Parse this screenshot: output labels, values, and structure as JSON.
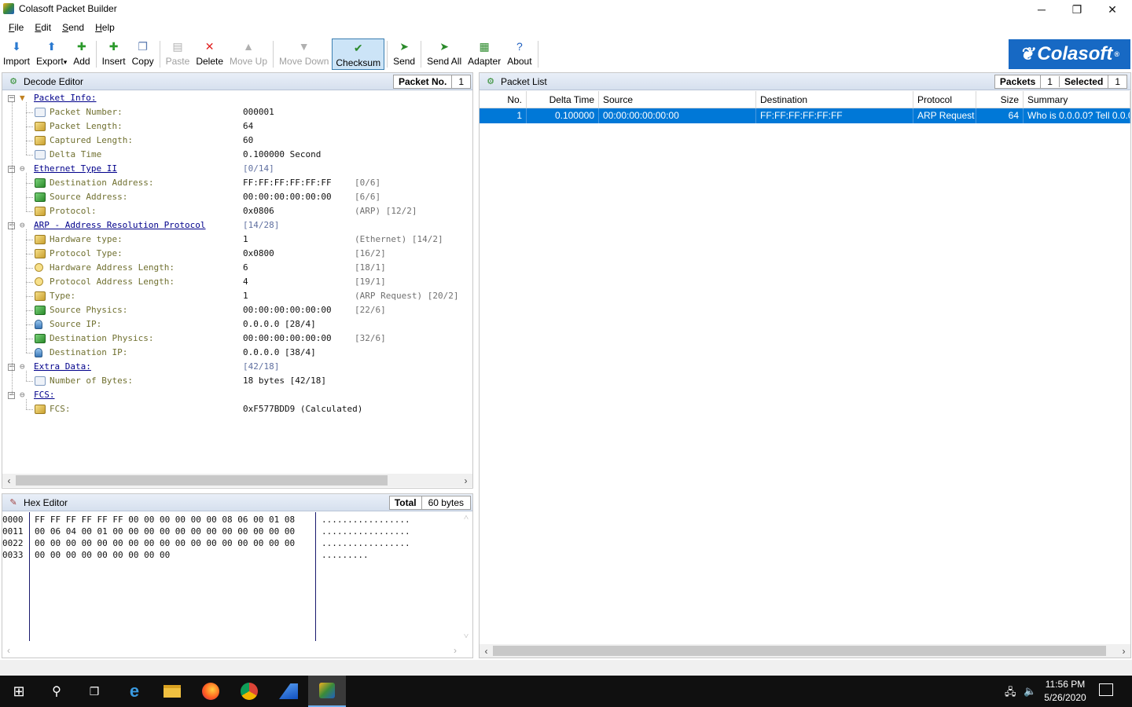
{
  "window": {
    "title": "Colasoft Packet Builder",
    "minimize": "─",
    "restore": "❐",
    "close": "✕"
  },
  "menu": [
    "File",
    "Edit",
    "Send",
    "Help"
  ],
  "toolbar": [
    {
      "label": "Import",
      "icon": "import-icon",
      "glyph": "⬇",
      "state": "normal"
    },
    {
      "label": "Export",
      "icon": "export-icon",
      "glyph": "⬆",
      "state": "normal",
      "dropdown": "▾"
    },
    {
      "label": "Add",
      "icon": "add-icon",
      "glyph": "✚",
      "state": "normal"
    },
    {
      "label": "Insert",
      "icon": "insert-icon",
      "glyph": "✚",
      "state": "normal"
    },
    {
      "label": "Copy",
      "icon": "copy-icon",
      "glyph": "❐",
      "state": "normal"
    },
    {
      "label": "Paste",
      "icon": "paste-icon",
      "glyph": "▤",
      "state": "disabled"
    },
    {
      "label": "Delete",
      "icon": "delete-icon",
      "glyph": "✕",
      "state": "normal"
    },
    {
      "label": "Move Up",
      "icon": "move-up-icon",
      "glyph": "▲",
      "state": "disabled"
    },
    {
      "label": "Move Down",
      "icon": "move-down-icon",
      "glyph": "▼",
      "state": "disabled"
    },
    {
      "label": "Checksum",
      "icon": "checksum-icon",
      "glyph": "✔",
      "state": "active"
    },
    {
      "label": "Send",
      "icon": "send-icon",
      "glyph": "➤",
      "state": "normal"
    },
    {
      "label": "Send All",
      "icon": "send-all-icon",
      "glyph": "➤",
      "state": "normal"
    },
    {
      "label": "Adapter",
      "icon": "adapter-icon",
      "glyph": "▦",
      "state": "normal"
    },
    {
      "label": "About",
      "icon": "about-icon",
      "glyph": "?",
      "state": "normal"
    }
  ],
  "logo": {
    "text": "Colasoft",
    "mark": "®"
  },
  "decode_editor": {
    "title": "Decode Editor",
    "packet_no_label": "Packet No.",
    "packet_no_value": "1",
    "rows": [
      {
        "level": 0,
        "kind": "group",
        "icon": "filter-icon",
        "label": "Packet Info:",
        "value": "",
        "extra": ""
      },
      {
        "level": 1,
        "kind": "field",
        "icon": "doc",
        "label": "Packet Number:",
        "value": "000001",
        "extra": ""
      },
      {
        "level": 1,
        "kind": "field",
        "icon": "key",
        "label": "Packet Length:",
        "value": "64",
        "extra": ""
      },
      {
        "level": 1,
        "kind": "field",
        "icon": "key",
        "label": "Captured Length:",
        "value": "60",
        "extra": ""
      },
      {
        "level": 1,
        "kind": "field",
        "icon": "doc",
        "label": "Delta Time",
        "value": "0.100000 Second",
        "extra": ""
      },
      {
        "level": 0,
        "kind": "group",
        "icon": "circle-icon",
        "label": "Ethernet Type II",
        "value": "[0/14]",
        "extra": ""
      },
      {
        "level": 1,
        "kind": "field",
        "icon": "net",
        "label": "Destination Address:",
        "value": "FF:FF:FF:FF:FF:FF",
        "extra": "[0/6]"
      },
      {
        "level": 1,
        "kind": "field",
        "icon": "net",
        "label": "Source Address:",
        "value": "00:00:00:00:00:00",
        "extra": "[6/6]"
      },
      {
        "level": 1,
        "kind": "field",
        "icon": "key",
        "label": "Protocol:",
        "value": "0x0806",
        "extra": "(ARP)  [12/2]"
      },
      {
        "level": 0,
        "kind": "group",
        "icon": "circle-icon",
        "label": "ARP - Address Resolution Protocol",
        "value": "[14/28]",
        "extra": ""
      },
      {
        "level": 1,
        "kind": "field",
        "icon": "key",
        "label": "Hardware type:",
        "value": "1",
        "extra": "(Ethernet)  [14/2]"
      },
      {
        "level": 1,
        "kind": "field",
        "icon": "key",
        "label": "Protocol Type:",
        "value": "0x0800",
        "extra": "[16/2]"
      },
      {
        "level": 1,
        "kind": "field",
        "icon": "cir",
        "label": "Hardware Address Length:",
        "value": "6",
        "extra": "[18/1]"
      },
      {
        "level": 1,
        "kind": "field",
        "icon": "cir",
        "label": "Protocol Address Length:",
        "value": "4",
        "extra": "[19/1]"
      },
      {
        "level": 1,
        "kind": "field",
        "icon": "key",
        "label": "Type:",
        "value": "1",
        "extra": "(ARP Request)  [20/2]"
      },
      {
        "level": 1,
        "kind": "field",
        "icon": "net",
        "label": "Source Physics:",
        "value": "00:00:00:00:00:00",
        "extra": "[22/6]"
      },
      {
        "level": 1,
        "kind": "field",
        "icon": "ip",
        "label": "Source IP:",
        "value": "0.0.0.0  [28/4]",
        "extra": ""
      },
      {
        "level": 1,
        "kind": "field",
        "icon": "net",
        "label": "Destination Physics:",
        "value": "00:00:00:00:00:00",
        "extra": "[32/6]"
      },
      {
        "level": 1,
        "kind": "field",
        "icon": "ip",
        "label": "Destination IP:",
        "value": "0.0.0.0  [38/4]",
        "extra": ""
      },
      {
        "level": 0,
        "kind": "group",
        "icon": "circle-icon",
        "label": "Extra Data:",
        "value": "[42/18]",
        "extra": ""
      },
      {
        "level": 1,
        "kind": "field",
        "icon": "doc",
        "label": "Number of Bytes:",
        "value": "18 bytes  [42/18]",
        "extra": ""
      },
      {
        "level": 0,
        "kind": "group",
        "icon": "circle-icon",
        "label": "FCS:",
        "value": "",
        "extra": ""
      },
      {
        "level": 1,
        "kind": "field",
        "icon": "key",
        "label": "FCS:",
        "value": "0xF577BDD9   (Calculated)",
        "extra": ""
      }
    ]
  },
  "hex_editor": {
    "title": "Hex Editor",
    "total_label": "Total",
    "total_value": "60 bytes",
    "lines": [
      {
        "offset": "0000",
        "hex": "FF FF FF FF FF FF 00 00 00 00 00 00 08 06 00 01 08",
        "ascii": "................."
      },
      {
        "offset": "0011",
        "hex": "00 06 04 00 01 00 00 00 00 00 00 00 00 00 00 00 00",
        "ascii": "................."
      },
      {
        "offset": "0022",
        "hex": "00 00 00 00 00 00 00 00 00 00 00 00 00 00 00 00 00",
        "ascii": "................."
      },
      {
        "offset": "0033",
        "hex": "00 00 00 00 00 00 00 00 00",
        "ascii": "........."
      }
    ]
  },
  "packet_list": {
    "title": "Packet List",
    "packets_label": "Packets",
    "packets_value": "1",
    "selected_label": "Selected",
    "selected_value": "1",
    "columns": [
      "No.",
      "Delta Time",
      "Source",
      "Destination",
      "Protocol",
      "Size",
      "Summary"
    ],
    "rows": [
      {
        "no": "1",
        "delta": "0.100000",
        "source": "00:00:00:00:00:00",
        "destination": "FF:FF:FF:FF:FF:FF",
        "protocol": "ARP Request",
        "size": "64",
        "summary": "Who is 0.0.0.0? Tell 0.0.0.0"
      }
    ]
  },
  "scroll": {
    "left": "‹",
    "right": "›",
    "up": "˄",
    "down": "˅"
  },
  "taskbar": {
    "items": [
      "start-icon",
      "search-icon",
      "task-view-icon",
      "edge-icon",
      "file-explorer-icon",
      "firefox-icon",
      "chrome-icon",
      "wireshark-icon",
      "colasoft-icon"
    ],
    "time": "11:56 PM",
    "date": "5/26/2020"
  }
}
